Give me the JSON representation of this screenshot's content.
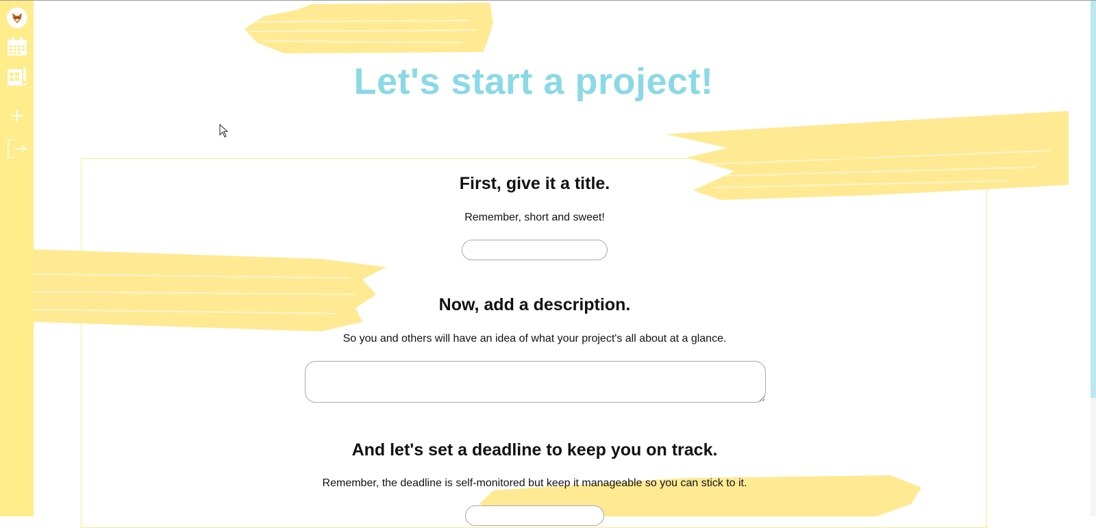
{
  "sidebar": {
    "items": [
      {
        "icon": "fox-avatar-icon"
      },
      {
        "icon": "calendar-icon"
      },
      {
        "icon": "projects-board-icon"
      },
      {
        "icon": "plus-icon"
      },
      {
        "icon": "logout-icon"
      }
    ]
  },
  "page": {
    "title": "Let's start a project!"
  },
  "form": {
    "title_section": {
      "heading": "First, give it a title.",
      "hint": "Remember, short and sweet!",
      "value": ""
    },
    "description_section": {
      "heading": "Now, add a description.",
      "hint": "So you and others will have an idea of what your project's all about at a glance.",
      "value": ""
    },
    "deadline_section": {
      "heading": "And let's set a deadline to keep you on track.",
      "hint": "Remember, the deadline is self-monitored but keep it manageable so you can stick to it."
    }
  },
  "colors": {
    "accent": "#8ad9e6",
    "sidebar": "#ffec8a",
    "paint": "#ffe680"
  }
}
